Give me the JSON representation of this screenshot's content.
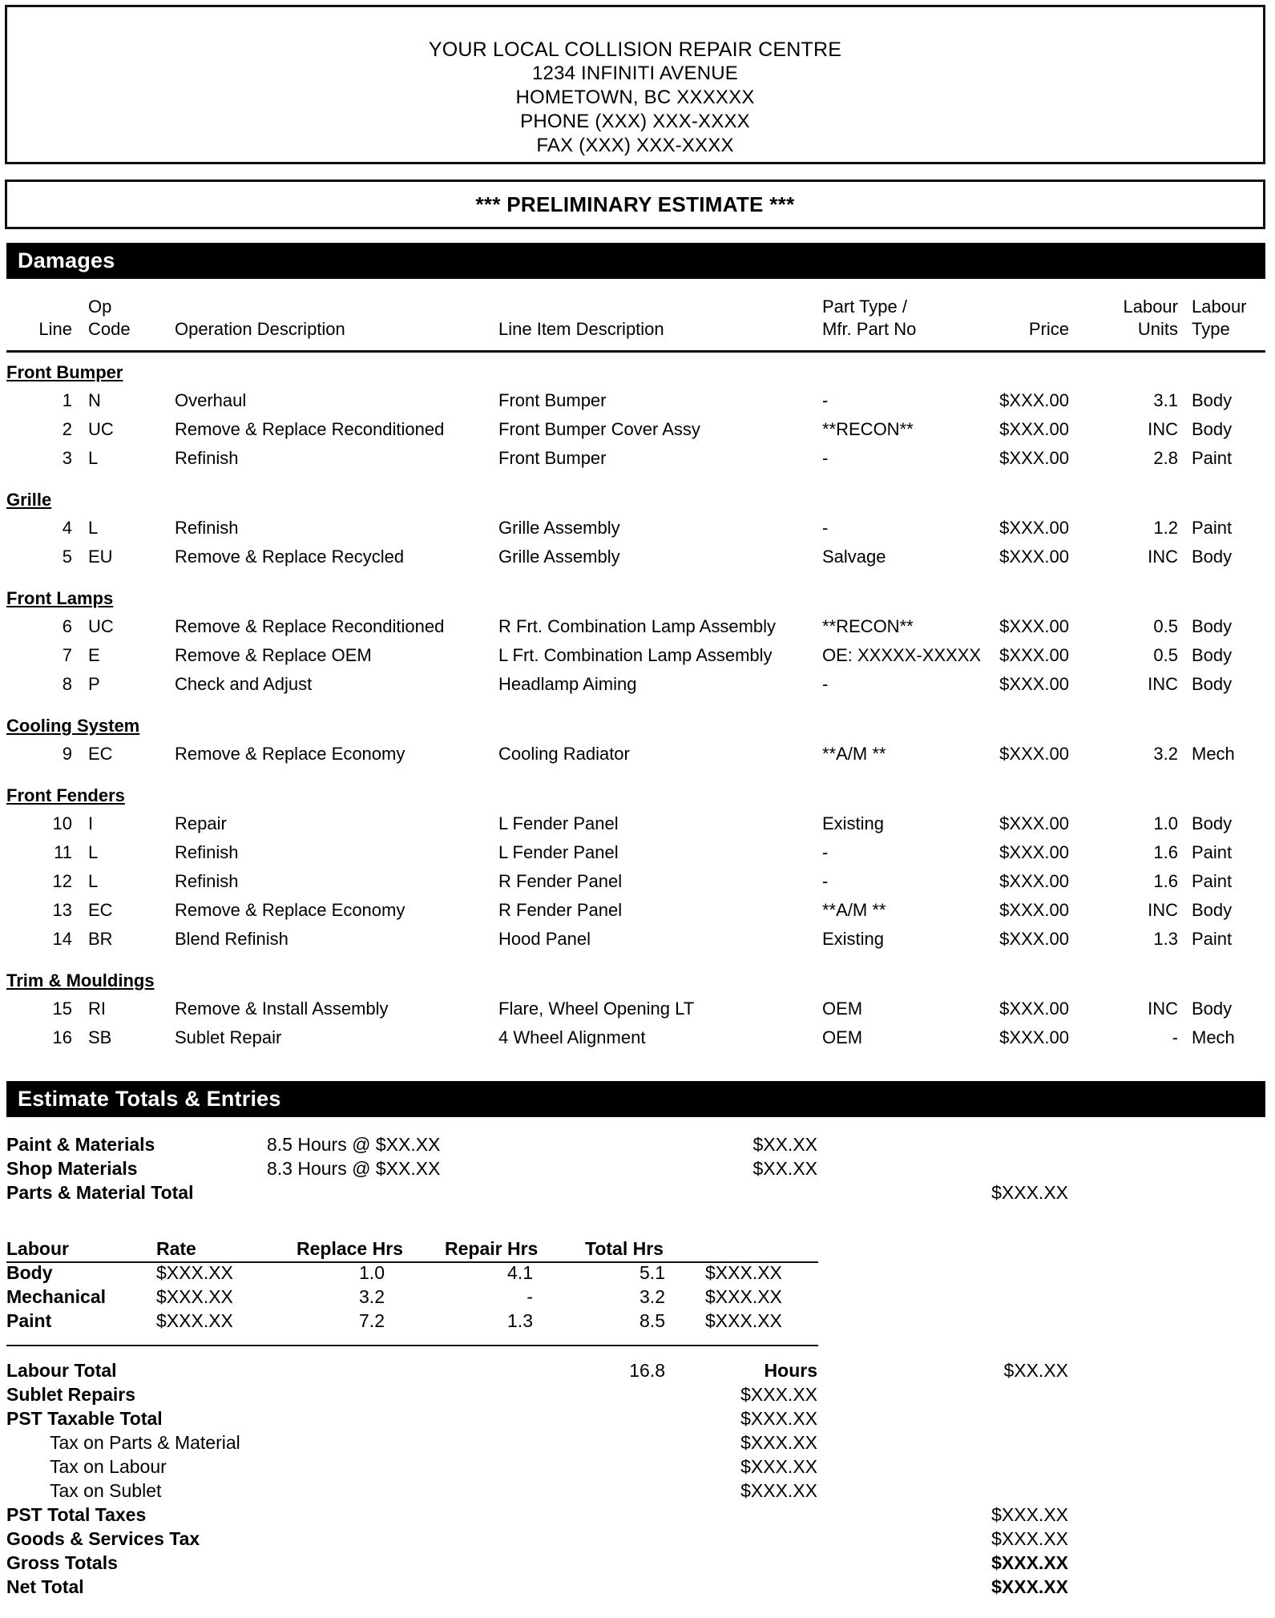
{
  "header": {
    "lines": [
      "YOUR LOCAL COLLISION REPAIR CENTRE",
      "1234 INFINITI AVENUE",
      "HOMETOWN, BC XXXXXX",
      "PHONE (XXX) XXX-XXXX",
      "FAX (XXX) XXX-XXXX"
    ],
    "estimate_title": "*** PRELIMINARY ESTIMATE ***"
  },
  "damages": {
    "section_label": "Damages",
    "columns": {
      "line": "Line",
      "op_code_1": "Op",
      "op_code_2": "Code",
      "operation_description": "Operation Description",
      "line_item_description": "Line Item Description",
      "part_type_1": "Part Type /",
      "part_type_2": "Mfr. Part No",
      "price": "Price",
      "labour_units_1": "Labour",
      "labour_units_2": "Units",
      "labour_type_1": "Labour",
      "labour_type_2": "Type"
    },
    "groups": [
      {
        "name": "Front Bumper",
        "rows": [
          {
            "line": "1",
            "op": "N",
            "opdesc": "Overhaul",
            "item": "Front Bumper",
            "part": "-",
            "price": "$XXX.00",
            "units": "3.1",
            "ltype": "Body"
          },
          {
            "line": "2",
            "op": "UC",
            "opdesc": "Remove & Replace Reconditioned",
            "item": "Front Bumper Cover Assy",
            "part": "**RECON**",
            "price": "$XXX.00",
            "units": "INC",
            "ltype": "Body"
          },
          {
            "line": "3",
            "op": "L",
            "opdesc": "Refinish",
            "item": "Front Bumper",
            "part": "-",
            "price": "$XXX.00",
            "units": "2.8",
            "ltype": "Paint"
          }
        ]
      },
      {
        "name": "Grille",
        "rows": [
          {
            "line": "4",
            "op": "L",
            "opdesc": "Refinish",
            "item": "Grille Assembly",
            "part": "-",
            "price": "$XXX.00",
            "units": "1.2",
            "ltype": "Paint"
          },
          {
            "line": "5",
            "op": "EU",
            "opdesc": "Remove & Replace Recycled",
            "item": "Grille Assembly",
            "part": "Salvage",
            "price": "$XXX.00",
            "units": "INC",
            "ltype": "Body"
          }
        ]
      },
      {
        "name": "Front Lamps",
        "rows": [
          {
            "line": "6",
            "op": "UC",
            "opdesc": "Remove & Replace Reconditioned",
            "item": "R Frt. Combination Lamp Assembly",
            "part": "**RECON**",
            "price": "$XXX.00",
            "units": "0.5",
            "ltype": "Body"
          },
          {
            "line": "7",
            "op": "E",
            "opdesc": "Remove & Replace OEM",
            "item": "L Frt. Combination Lamp Assembly",
            "part": "OE: XXXXX-XXXXX",
            "price": "$XXX.00",
            "units": "0.5",
            "ltype": "Body"
          },
          {
            "line": "8",
            "op": "P",
            "opdesc": "Check and Adjust",
            "item": "Headlamp Aiming",
            "part": "-",
            "price": "$XXX.00",
            "units": "INC",
            "ltype": "Body"
          }
        ]
      },
      {
        "name": "Cooling System",
        "rows": [
          {
            "line": "9",
            "op": "EC",
            "opdesc": "Remove & Replace Economy",
            "item": "Cooling Radiator",
            "part": "**A/M **",
            "price": "$XXX.00",
            "units": "3.2",
            "ltype": "Mech"
          }
        ]
      },
      {
        "name": "Front Fenders",
        "rows": [
          {
            "line": "10",
            "op": "I",
            "opdesc": "Repair",
            "item": "L Fender Panel",
            "part": "Existing",
            "price": "$XXX.00",
            "units": "1.0",
            "ltype": "Body"
          },
          {
            "line": "11",
            "op": "L",
            "opdesc": "Refinish",
            "item": "L Fender Panel",
            "part": "-",
            "price": "$XXX.00",
            "units": "1.6",
            "ltype": "Paint"
          },
          {
            "line": "12",
            "op": "L",
            "opdesc": "Refinish",
            "item": "R Fender Panel",
            "part": "-",
            "price": "$XXX.00",
            "units": "1.6",
            "ltype": "Paint"
          },
          {
            "line": "13",
            "op": "EC",
            "opdesc": "Remove & Replace Economy",
            "item": "R Fender Panel",
            "part": "**A/M **",
            "price": "$XXX.00",
            "units": "INC",
            "ltype": "Body"
          },
          {
            "line": "14",
            "op": "BR",
            "opdesc": "Blend Refinish",
            "item": "Hood Panel",
            "part": "Existing",
            "price": "$XXX.00",
            "units": "1.3",
            "ltype": "Paint"
          }
        ]
      },
      {
        "name": "Trim & Mouldings",
        "rows": [
          {
            "line": "15",
            "op": "RI",
            "opdesc": "Remove & Install Assembly",
            "item": "Flare, Wheel Opening LT",
            "part": "OEM",
            "price": "$XXX.00",
            "units": "INC",
            "ltype": "Body"
          },
          {
            "line": "16",
            "op": "SB",
            "opdesc": "Sublet Repair",
            "item": "4 Wheel Alignment",
            "part": "OEM",
            "price": "$XXX.00",
            "units": "-",
            "ltype": "Mech"
          }
        ]
      }
    ]
  },
  "totals": {
    "section_label": "Estimate Totals & Entries",
    "materials": [
      {
        "label": "Paint & Materials",
        "desc": "8.5 Hours @ $XX.XX",
        "mid": "$XX.XX",
        "right": ""
      },
      {
        "label": "Shop Materials",
        "desc": "8.3 Hours @ $XX.XX",
        "mid": "$XX.XX",
        "right": ""
      },
      {
        "label": "Parts & Material Total",
        "desc": "",
        "mid": "",
        "right": "$XXX.XX"
      }
    ],
    "labour_table": {
      "headers": {
        "category": "Labour",
        "rate": "Rate",
        "replace_hrs": "Replace Hrs",
        "repair_hrs": "Repair Hrs",
        "total_hrs": "Total Hrs"
      },
      "rows": [
        {
          "category": "Body",
          "rate": "$XXX.XX",
          "replace": "1.0",
          "repair": "4.1",
          "total": "5.1",
          "amount": "$XXX.XX"
        },
        {
          "category": "Mechanical",
          "rate": "$XXX.XX",
          "replace": "3.2",
          "repair": "-",
          "total": "3.2",
          "amount": "$XXX.XX"
        },
        {
          "category": "Paint",
          "rate": "$XXX.XX",
          "replace": "7.2",
          "repair": "1.3",
          "total": "8.5",
          "amount": "$XXX.XX"
        }
      ]
    },
    "labour_total": {
      "label": "Labour Total",
      "hours": "16.8",
      "hours_word": "Hours",
      "amount": "$XX.XX"
    },
    "lines": [
      {
        "label": "Sublet Repairs",
        "indent": false,
        "bold": true,
        "mid": "$XXX.XX",
        "far": ""
      },
      {
        "label": "PST Taxable Total",
        "indent": false,
        "bold": true,
        "mid": "$XXX.XX",
        "far": ""
      },
      {
        "label": "Tax on Parts & Material",
        "indent": true,
        "bold": false,
        "mid": "$XXX.XX",
        "far": ""
      },
      {
        "label": "Tax on Labour",
        "indent": true,
        "bold": false,
        "mid": "$XXX.XX",
        "far": ""
      },
      {
        "label": "Tax on Sublet",
        "indent": true,
        "bold": false,
        "mid": "$XXX.XX",
        "far": ""
      },
      {
        "label": "PST  Total Taxes",
        "indent": false,
        "bold": true,
        "mid": "",
        "far": "$XXX.XX"
      },
      {
        "label": "Goods & Services Tax",
        "indent": false,
        "bold": true,
        "mid": "",
        "far": "$XXX.XX"
      },
      {
        "label": "Gross Totals",
        "indent": false,
        "bold": true,
        "mid": "",
        "far": "$XXX.XX",
        "far_bold": true
      },
      {
        "label": "Net Total",
        "indent": false,
        "bold": true,
        "mid": "",
        "far": "$XXX.XX",
        "far_bold": true
      }
    ]
  }
}
